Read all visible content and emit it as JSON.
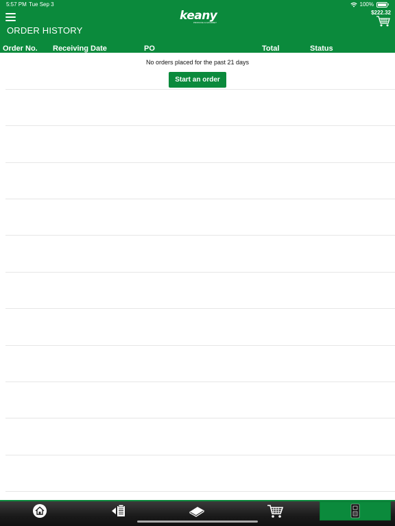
{
  "status_bar": {
    "time": "5:57 PM",
    "date": "Tue Sep 3",
    "battery": "100%"
  },
  "header": {
    "logo_text": "keany",
    "logo_subtext": "PRODUCE & GOURMET",
    "cart_total": "$222.32",
    "page_title": "ORDER HISTORY"
  },
  "table": {
    "columns": [
      "Order No.",
      "Receiving Date",
      "PO",
      "Total",
      "Status"
    ],
    "rows": []
  },
  "empty_state": {
    "message": "No orders placed for the past 21 days",
    "action_label": "Start an order"
  },
  "tabbar": {
    "tabs": [
      {
        "icon": "home-icon",
        "active": false
      },
      {
        "icon": "order-guide-icon",
        "active": false
      },
      {
        "icon": "catalog-icon",
        "active": false
      },
      {
        "icon": "cart-icon",
        "active": false
      },
      {
        "icon": "order-history-icon",
        "active": true
      }
    ]
  },
  "colors": {
    "brand_green": "#0b8a3c",
    "tabbar_dark": "#1a1a1a"
  }
}
